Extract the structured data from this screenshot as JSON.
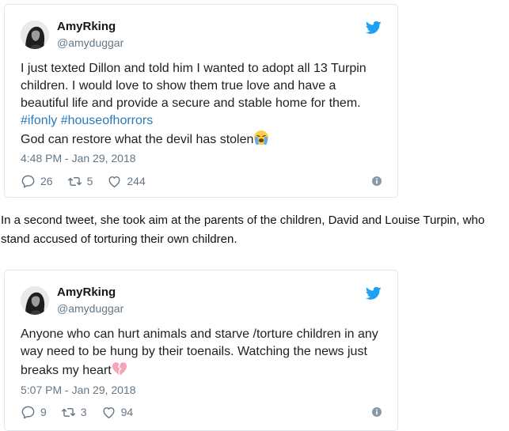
{
  "tweets": [
    {
      "display_name": "AmyRking",
      "handle": "@amyduggar",
      "text_line1": "I just texted Dillon and told him I wanted to adopt all 13 Turpin children. I would love to show them true love and have a beautiful life and provide a secure and stable home for them.",
      "hashtag1": "#ifonly",
      "hashtag2": "#houseofhorrors",
      "text_line3": "God can restore what the devil has stolen",
      "emoji": "crying-face-icon",
      "timestamp": "4:48 PM - Jan 29, 2018",
      "replies": "26",
      "retweets": "5",
      "likes": "244"
    },
    {
      "display_name": "AmyRking",
      "handle": "@amyduggar",
      "text": "Anyone who can hurt animals and starve /torture children in any way need to be hung by their toenails. Watching the news just breaks my heart",
      "emoji": "broken-heart-icon",
      "timestamp": "5:07 PM - Jan 29, 2018",
      "replies": "9",
      "retweets": "3",
      "likes": "94"
    }
  ],
  "article": {
    "paragraph": "In a second tweet, she took aim at the parents of the children, David and Louise Turpin, who stand accused of torturing their own children."
  },
  "colors": {
    "twitter_blue": "#1da1f2",
    "hashtag": "#2b7bb9",
    "muted": "#657786",
    "border": "#e1e8ed",
    "broken_heart": "#f4a3b8"
  }
}
